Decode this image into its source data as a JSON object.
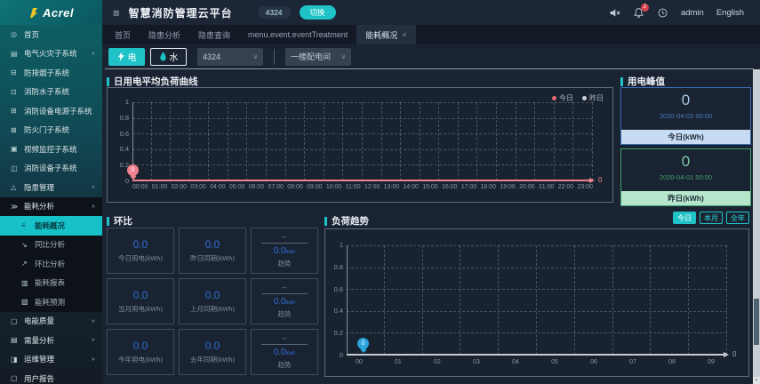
{
  "header": {
    "logo": "Acrel",
    "title": "智慧消防管理云平台",
    "badge": "4324",
    "switch_label": "切换",
    "bell_badge": "2",
    "user": "admin",
    "lang": "English"
  },
  "sidebar": {
    "items_top": [
      {
        "icon": "home",
        "label": "首页"
      },
      {
        "icon": "electric-fire",
        "label": "电气火灾子系统",
        "chevron": "chevron-down"
      },
      {
        "icon": "smoke-exhaust",
        "label": "防排烟子系统"
      },
      {
        "icon": "fire-water",
        "label": "消防水子系统"
      },
      {
        "icon": "fire-power",
        "label": "消防设备电源子系统"
      },
      {
        "icon": "fire-door",
        "label": "防火门子系统"
      },
      {
        "icon": "video-monitor",
        "label": "视频监控子系统"
      },
      {
        "icon": "fire-device",
        "label": "消防设备子系统"
      },
      {
        "icon": "hazard-manage",
        "label": "隐患管理",
        "chevron": "chevron-down"
      },
      {
        "icon": "energy-analysis",
        "label": "能耗分析",
        "chevron": "chevron-up",
        "cls": "open"
      }
    ],
    "submenu": [
      {
        "icon": "energy-overview",
        "label": "能耗概况",
        "active": true
      },
      {
        "icon": "yoy-analysis",
        "label": "同比分析"
      },
      {
        "icon": "mom-analysis",
        "label": "环比分析"
      },
      {
        "icon": "energy-report",
        "label": "能耗报表"
      },
      {
        "icon": "energy-forecast",
        "label": "能耗预测"
      }
    ],
    "items_bottom": [
      {
        "icon": "power-quality",
        "label": "电能质量",
        "chevron": "chevron-down"
      },
      {
        "icon": "demand-analysis",
        "label": "需量分析",
        "chevron": "chevron-down"
      },
      {
        "icon": "ops-manage",
        "label": "运维管理",
        "chevron": "chevron-down"
      },
      {
        "icon": "user-report",
        "label": "用户报告"
      }
    ]
  },
  "tabs": [
    {
      "label": "首页"
    },
    {
      "label": "隐患分析"
    },
    {
      "label": "隐患查询"
    },
    {
      "label": "menu.event.eventTreatment"
    },
    {
      "label": "能耗概况",
      "active": true
    }
  ],
  "filters": {
    "electric_label": "电",
    "water_label": "水",
    "select1": "4324",
    "select2": "一楼配电间"
  },
  "chart_data": [
    {
      "type": "line",
      "title": "日用电平均负荷曲线",
      "x": [
        "00:00",
        "01:00",
        "02:00",
        "03:00",
        "04:00",
        "05:00",
        "06:00",
        "07:00",
        "08:00",
        "09:00",
        "10:00",
        "11:00",
        "12:00",
        "13:00",
        "14:00",
        "15:00",
        "16:00",
        "17:00",
        "18:00",
        "19:00",
        "20:00",
        "21:00",
        "22:00",
        "23:00"
      ],
      "yticks": [
        "1",
        "0.8",
        "0.6",
        "0.4",
        "0.2",
        "0"
      ],
      "ylim": [
        0,
        1
      ],
      "grid": true,
      "legend_position": "top-right",
      "series": [
        {
          "name": "今日",
          "color": "#e06a6a",
          "values": [
            0,
            0,
            0,
            0,
            0,
            0,
            0,
            0,
            0,
            0,
            0,
            0,
            0,
            0,
            0,
            0,
            0,
            0,
            0,
            0,
            0,
            0,
            0,
            0
          ]
        },
        {
          "name": "昨日",
          "color": "#ccd2dc",
          "values": []
        }
      ],
      "marker": {
        "x": "00:00",
        "value": "0"
      },
      "axis_end_label": "0"
    },
    {
      "type": "line",
      "title": "负荷趋势",
      "x": [
        "00",
        "01",
        "02",
        "03",
        "04",
        "05",
        "06",
        "07",
        "08",
        "09"
      ],
      "yticks": [
        "1",
        "0.8",
        "0.6",
        "0.4",
        "0.2",
        "0"
      ],
      "ylim": [
        0,
        1
      ],
      "grid": true,
      "series": [
        {
          "name": "负荷",
          "color": "#2ba4de",
          "values": [
            0
          ]
        }
      ],
      "marker": {
        "x": "00",
        "value": "0"
      },
      "axis_end_label": "0"
    }
  ],
  "peak": {
    "title": "用电峰值",
    "cards": [
      {
        "value": "0",
        "date": "2020-04-02 00:00",
        "label": "今日(kWh)",
        "cls": "blue"
      },
      {
        "value": "0",
        "date": "2020-04-01 00:00",
        "label": "昨日(kWh)",
        "cls": "green"
      }
    ]
  },
  "huanbi": {
    "title": "环比",
    "cards": [
      {
        "value": "0.0",
        "label": "今日用电(kWh)"
      },
      {
        "value": "0.0",
        "label": "昨日同期(kWh)"
      },
      {
        "cls": "trend",
        "top": "--",
        "value": "0.0",
        "unit": "kwh",
        "label": "趋势"
      },
      {
        "value": "0.0",
        "label": "当月用电(kWh)"
      },
      {
        "value": "0.0",
        "label": "上月同期(kWh)"
      },
      {
        "cls": "trend",
        "top": "--",
        "value": "0.0",
        "unit": "kwh",
        "label": "趋势"
      },
      {
        "value": "0.0",
        "label": "今年用电(kWh)"
      },
      {
        "value": "0.0",
        "label": "去年同期(kWh)"
      },
      {
        "cls": "trend",
        "top": "--",
        "value": "0.0",
        "unit": "kwh",
        "label": "趋势"
      }
    ]
  },
  "load_trend": {
    "buttons": [
      {
        "label": "今日",
        "active": true
      },
      {
        "label": "本月"
      },
      {
        "label": "全年"
      }
    ]
  }
}
